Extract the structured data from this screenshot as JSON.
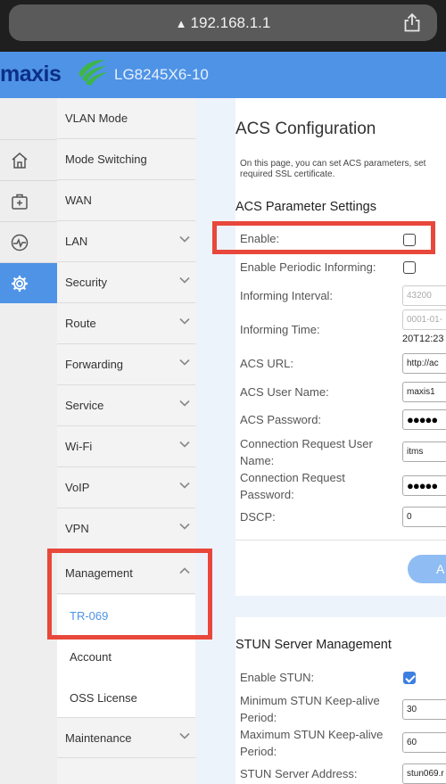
{
  "browser": {
    "url": "192.168.1.1",
    "warning_glyph": "▲"
  },
  "header": {
    "brand": "maxis",
    "model": "LG8245X6-10",
    "accent_color": "#4e93e6",
    "brand_color": "#0c2f87",
    "logo_color": "#3db54a"
  },
  "rail": {
    "items": [
      {
        "icon": "home-icon"
      },
      {
        "icon": "medical-box-icon"
      },
      {
        "icon": "pulse-icon"
      },
      {
        "icon": "gear-icon",
        "active": true
      }
    ]
  },
  "nav": {
    "items": [
      {
        "label": "VLAN Mode"
      },
      {
        "label": "Mode Switching"
      },
      {
        "label": "WAN"
      },
      {
        "label": "LAN",
        "expandable": true
      },
      {
        "label": "Security",
        "expandable": true
      },
      {
        "label": "Route",
        "expandable": true
      },
      {
        "label": "Forwarding",
        "expandable": true
      },
      {
        "label": "Service",
        "expandable": true
      },
      {
        "label": "Wi-Fi",
        "expandable": true
      },
      {
        "label": "VoIP",
        "expandable": true
      },
      {
        "label": "VPN",
        "expandable": true
      },
      {
        "label": "Management",
        "expanded": true
      },
      {
        "label": "TR-069",
        "sub": true,
        "selected": true
      },
      {
        "label": "Account",
        "sub": true
      },
      {
        "label": "OSS License",
        "sub": true
      },
      {
        "label": "Maintenance",
        "expandable": true
      }
    ]
  },
  "acs": {
    "title": "ACS Configuration",
    "description": "On this page, you can set ACS parameters, set required SSL certificate.",
    "section_title": "ACS Parameter Settings",
    "enable_label": "Enable:",
    "enable_checked": false,
    "periodic_label": "Enable Periodic Informing:",
    "periodic_checked": false,
    "interval_label": "Informing Interval:",
    "interval_placeholder": "43200",
    "time_label": "Informing Time:",
    "time_placeholder": "0001-01-",
    "time_value": "20T12:23",
    "url_label": "ACS URL:",
    "url_value": "http://ac",
    "user_label": "ACS User Name:",
    "user_value": "maxis1",
    "password_label": "ACS Password:",
    "password_value": "●●●●●",
    "conn_user_label": "Connection Request User Name:",
    "conn_user_value": "itms",
    "conn_pass_label": "Connection Request Password:",
    "conn_pass_value": "●●●●●",
    "dscp_label": "DSCP:",
    "dscp_value": "0",
    "apply_label": "A"
  },
  "stun": {
    "section_title": "STUN Server Management",
    "enable_label": "Enable STUN:",
    "enable_checked": true,
    "min_label": "Minimum STUN Keep-alive Period:",
    "min_value": "30",
    "max_label": "Maximum STUN Keep-alive Period:",
    "max_value": "60",
    "addr_label": "STUN Server Address:",
    "addr_value": "stun069.r"
  }
}
